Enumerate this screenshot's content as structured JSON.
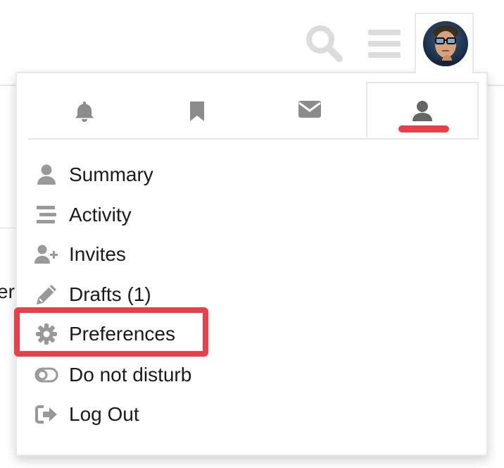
{
  "header": {
    "search_icon": "search-icon",
    "menu_icon": "hamburger-icon",
    "avatar": "user-avatar"
  },
  "background": {
    "partial_text": "er"
  },
  "tabs": [
    {
      "icon": "bell-icon",
      "active": false
    },
    {
      "icon": "bookmark-icon",
      "active": false
    },
    {
      "icon": "envelope-icon",
      "active": false
    },
    {
      "icon": "user-icon",
      "active": true
    }
  ],
  "menu": {
    "items": [
      {
        "label": "Summary",
        "icon": "user-icon"
      },
      {
        "label": "Activity",
        "icon": "stream-icon"
      },
      {
        "label": "Invites",
        "icon": "user-plus-icon"
      },
      {
        "label": "Drafts (1)",
        "icon": "pencil-icon"
      },
      {
        "label": "Preferences",
        "icon": "cog-icon",
        "highlighted": true
      },
      {
        "label": "Do not disturb",
        "icon": "toggle-off-icon"
      },
      {
        "label": "Log Out",
        "icon": "sign-out-icon"
      }
    ]
  },
  "colors": {
    "accent": "#e8404a",
    "icon_gray": "#999999",
    "icon_dark": "#8c8c8c",
    "text": "#1a1a1a"
  }
}
